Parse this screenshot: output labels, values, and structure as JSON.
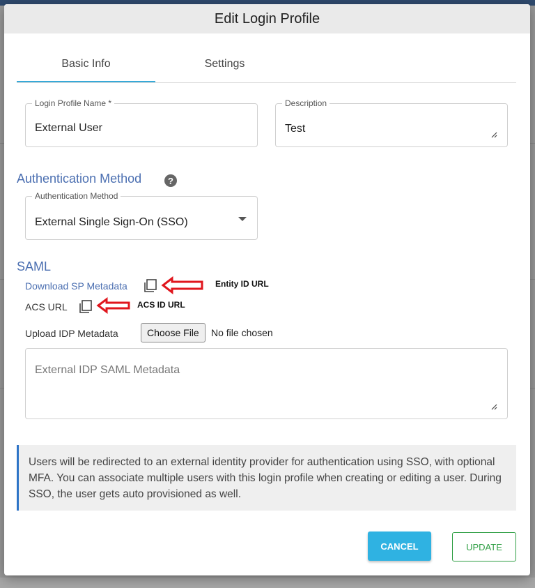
{
  "modal": {
    "title": "Edit Login Profile"
  },
  "tabs": [
    {
      "label": "Basic Info",
      "active": true
    },
    {
      "label": "Settings",
      "active": false
    }
  ],
  "fields": {
    "profile_name": {
      "label": "Login Profile Name *",
      "value": "External User"
    },
    "description": {
      "label": "Description",
      "value": "Test"
    }
  },
  "auth": {
    "section_title": "Authentication Method",
    "help_icon": "?",
    "method_label": "Authentication Method",
    "method_value": "External Single Sign-On (SSO)"
  },
  "saml": {
    "section_title": "SAML",
    "download_link": "Download SP Metadata",
    "acs_label": "ACS URL",
    "entity_annotation": "Entity ID URL",
    "acs_annotation": "ACS ID URL",
    "upload_label": "Upload IDP Metadata",
    "choose_file": "Choose File",
    "file_status": "No file chosen",
    "metadata_placeholder": "External IDP SAML Metadata"
  },
  "info": {
    "text": "Users will be redirected to an external identity provider for authentication using SSO, with optional MFA. You can associate multiple users with this login profile when creating or editing a user. During SSO, the user gets auto provisioned as well."
  },
  "buttons": {
    "cancel": "CANCEL",
    "update": "UPDATE"
  },
  "colors": {
    "accent": "#4b6fb1",
    "tab_indicator": "#36a9d8",
    "cancel_bg": "#2fb2e2",
    "update_border": "#2e9e43",
    "annotation_arrow": "#e0161d"
  }
}
